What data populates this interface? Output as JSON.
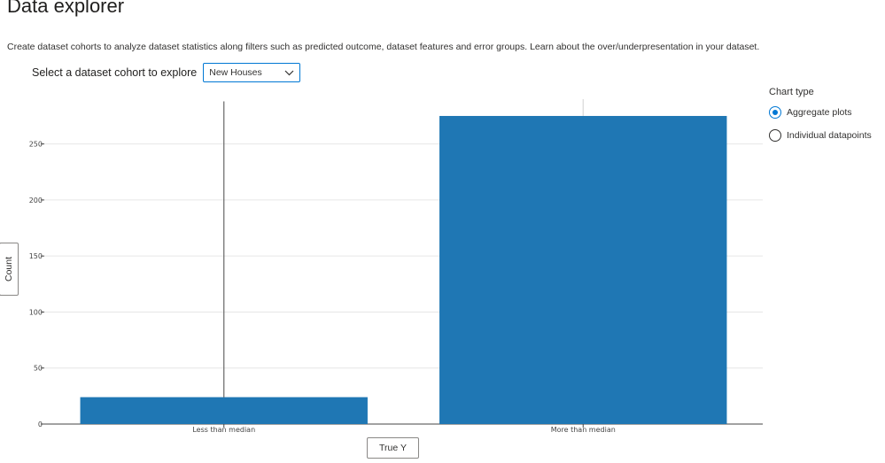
{
  "page": {
    "title": "Data explorer",
    "description": "Create dataset cohorts to analyze dataset statistics along filters such as predicted outcome, dataset features and error groups. Learn about the over/underpresentation in your dataset."
  },
  "cohort_selector": {
    "label": "Select a dataset cohort to explore",
    "selected": "New Houses",
    "icon": "chevron-down-icon"
  },
  "chart_type": {
    "label": "Chart type",
    "options": [
      {
        "label": "Aggregate plots",
        "checked": true
      },
      {
        "label": "Individual datapoints",
        "checked": false
      }
    ]
  },
  "axes": {
    "y_button_label": "Count",
    "x_button_label": "True Y"
  },
  "colors": {
    "bar": "#1f77b4",
    "accent": "#0078d4"
  },
  "chart_data": {
    "type": "bar",
    "categories": [
      "Less than median",
      "More than median"
    ],
    "values": [
      24,
      275
    ],
    "error_upper": [
      288,
      290
    ],
    "ylim": [
      0,
      290
    ],
    "yticks": [
      0,
      50,
      100,
      150,
      200,
      250
    ],
    "xlabel": "True Y",
    "ylabel": "Count",
    "grid": true
  }
}
